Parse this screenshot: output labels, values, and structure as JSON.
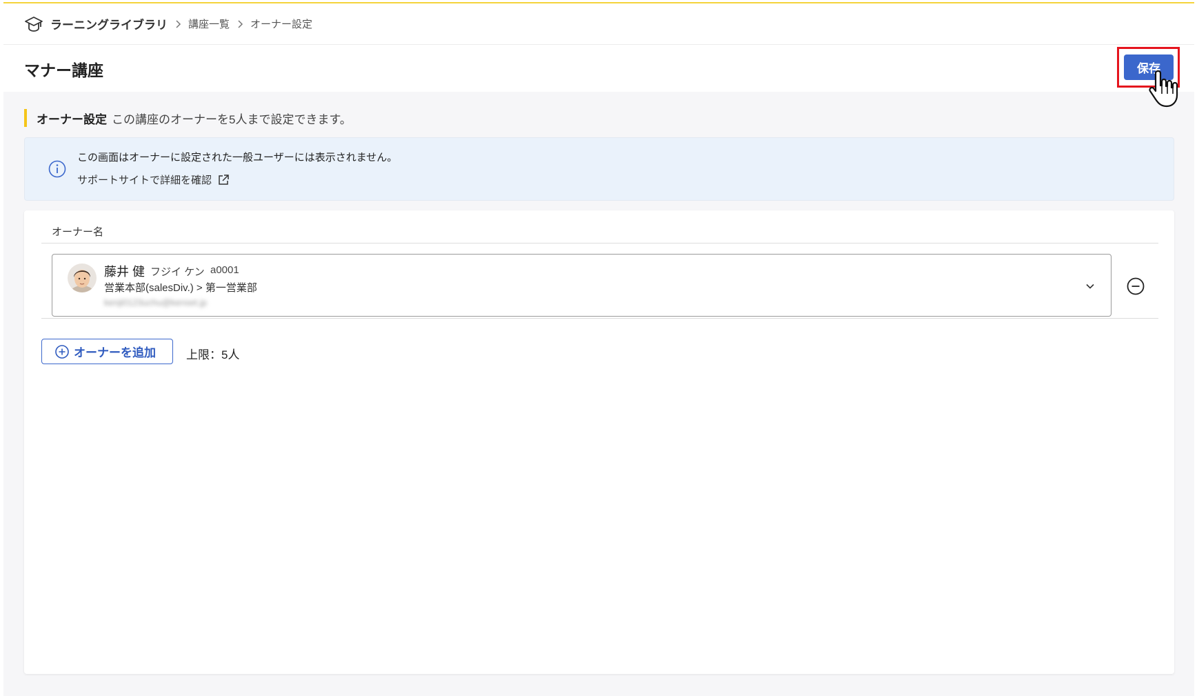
{
  "breadcrumb": {
    "root": "ラーニングライブラリ",
    "items": [
      "講座一覧",
      "オーナー設定"
    ]
  },
  "page": {
    "title": "マナー講座",
    "save_label": "保存"
  },
  "section": {
    "label": "オーナー設定",
    "description": "この講座のオーナーを5人まで設定できます。"
  },
  "info": {
    "message": "この画面はオーナーに設定された一般ユーザーには表示されません。",
    "link_label": "サポートサイトで詳細を確認"
  },
  "owners": {
    "column_header": "オーナー名",
    "items": [
      {
        "name": "藤井 健",
        "kana": "フジイ ケン",
        "id": "a0001",
        "department": "営業本部(salesDiv.) > 第一営業部",
        "email": "kenji0123uchu@kenset.jp"
      }
    ],
    "add_label": "オーナーを追加",
    "limit": "上限：5人"
  },
  "colors": {
    "accent": "#3b67cc",
    "highlight_border": "#e5141d",
    "section_bar": "#f5c51a",
    "info_bg": "#eaf2fb"
  },
  "icons": {
    "breadcrumb": "graduation-cap-icon",
    "info": "info-circle-icon",
    "external_link": "external-link-icon",
    "dropdown": "chevron-down-icon",
    "remove": "minus-circle-icon",
    "add": "plus-circle-icon",
    "cursor": "hand-pointer-icon"
  }
}
